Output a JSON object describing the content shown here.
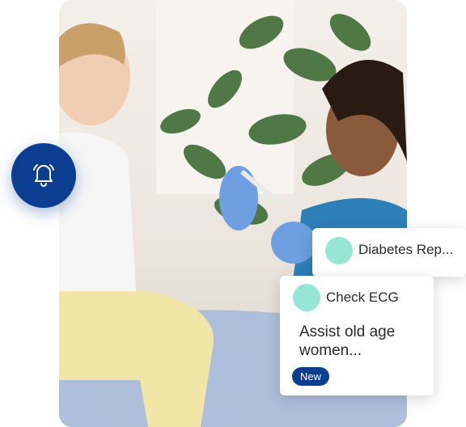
{
  "icons": {
    "notification": "bell-icon"
  },
  "colors": {
    "accent": "#0b3d91",
    "avatar": "#96e6d6"
  },
  "cards": [
    {
      "title": "Diabetes Rep..."
    },
    {
      "title": "Check ECG",
      "body": "Assist old age women...",
      "badge": "New"
    }
  ]
}
